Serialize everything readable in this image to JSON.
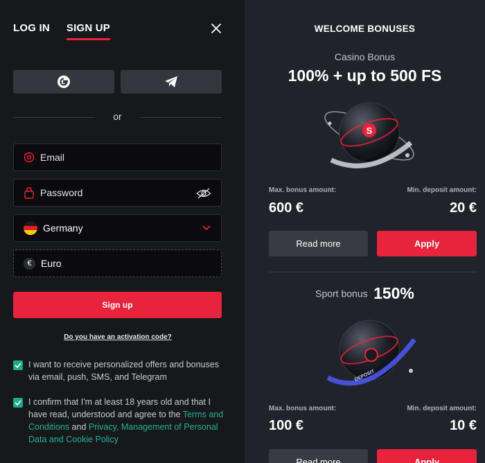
{
  "auth": {
    "tabs": [
      {
        "label": "LOG IN",
        "active": false
      },
      {
        "label": "SIGN UP",
        "active": true
      }
    ],
    "or_text": "or",
    "email_placeholder": "Email",
    "password_placeholder": "Password",
    "country": "Germany",
    "currency_symbol": "€",
    "currency": "Euro",
    "signup_label": "Sign up",
    "activation_link": "Do you have an activation code?",
    "consent_offers": "I want to receive personalized offers and bonuses via email, push, SMS, and Telegram",
    "consent_age_prefix": "I confirm that I'm at least 18 years old and that I have read, understood and agree to the ",
    "terms_link": "Terms and Conditions",
    "consent_and": " and ",
    "privacy_link": "Privacy, Management of Personal Data and Cookie Policy"
  },
  "bonuses": {
    "title": "WELCOME BONUSES",
    "casino": {
      "subtitle": "Casino Bonus",
      "headline": "100% + up to 500 FS",
      "max_label": "Max. bonus amount:",
      "max_value": "600 €",
      "min_label": "Min. deposit amount:",
      "min_value": "20 €",
      "read_more": "Read more",
      "apply": "Apply"
    },
    "sport": {
      "subtitle": "Sport bonus",
      "headline": "150%",
      "max_label": "Max. bonus amount:",
      "max_value": "100 €",
      "min_label": "Min. deposit amount:",
      "min_value": "10 €",
      "read_more": "Read more",
      "apply": "Apply"
    },
    "ring_text": "DEPOSIT"
  },
  "colors": {
    "accent": "#e8243c",
    "check": "#1fa88a",
    "link": "#1fb391"
  }
}
